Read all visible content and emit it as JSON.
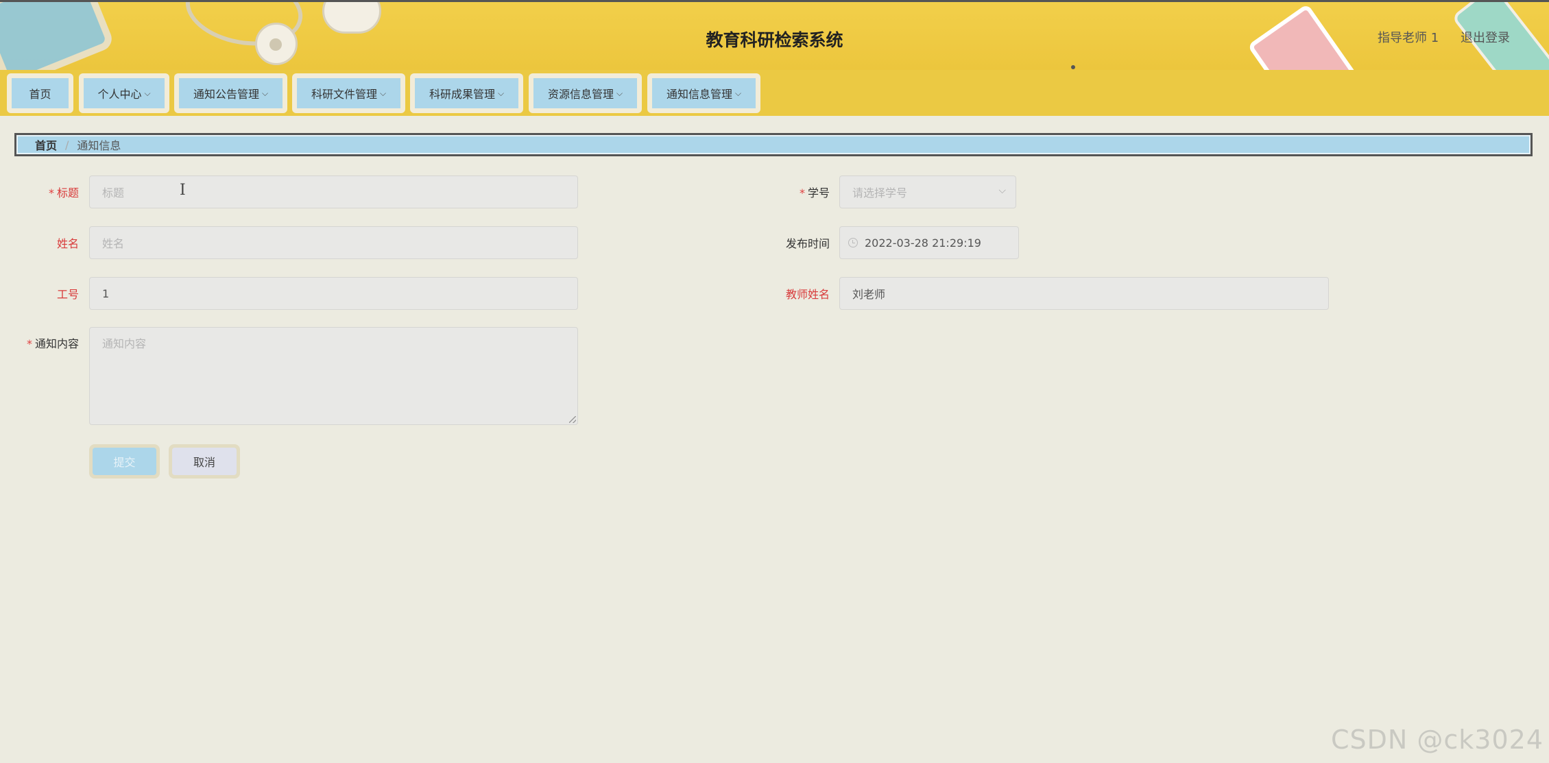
{
  "header": {
    "title": "教育科研检索系统",
    "user_name": "指导老师 1",
    "logout": "退出登录"
  },
  "nav": {
    "items": [
      {
        "label": "首页",
        "has_dropdown": false
      },
      {
        "label": "个人中心",
        "has_dropdown": true
      },
      {
        "label": "通知公告管理",
        "has_dropdown": true
      },
      {
        "label": "科研文件管理",
        "has_dropdown": true
      },
      {
        "label": "科研成果管理",
        "has_dropdown": true
      },
      {
        "label": "资源信息管理",
        "has_dropdown": true
      },
      {
        "label": "通知信息管理",
        "has_dropdown": true
      }
    ],
    "chevron": "⌵"
  },
  "breadcrumb": {
    "home": "首页",
    "separator": "/",
    "current": "通知信息"
  },
  "form": {
    "title": {
      "label": "标题",
      "required": true,
      "placeholder": "标题",
      "value": ""
    },
    "student_no": {
      "label": "学号",
      "required": true,
      "placeholder": "请选择学号",
      "value": ""
    },
    "name": {
      "label": "姓名",
      "placeholder": "姓名",
      "value": ""
    },
    "publish_time": {
      "label": "发布时间",
      "value": "2022-03-28 21:29:19"
    },
    "work_no": {
      "label": "工号",
      "value": "1"
    },
    "teacher_name": {
      "label": "教师姓名",
      "value": "刘老师"
    },
    "content": {
      "label": "通知内容",
      "required": true,
      "placeholder": "通知内容",
      "value": ""
    },
    "required_mark": "*",
    "submit": "提交",
    "cancel": "取消"
  },
  "colors": {
    "header_yellow": "#ecc63d",
    "nav_blue": "#acd6ea",
    "background": "#ecebe0",
    "label_red": "#d83b3b"
  },
  "watermark": "CSDN @ck3024"
}
